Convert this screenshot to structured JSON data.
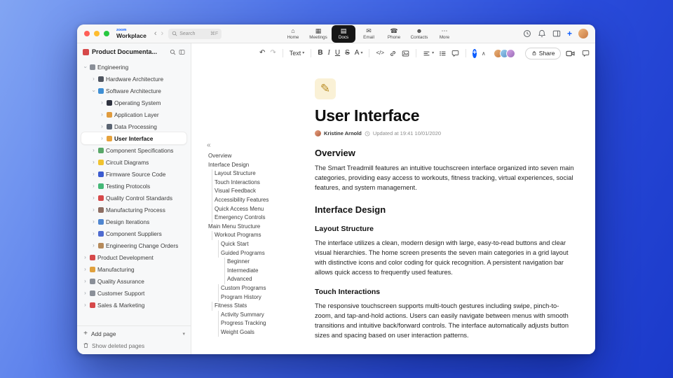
{
  "colors": {
    "accent": "#0b5cff",
    "active_tab_bg": "#161616",
    "desktop_gradient": [
      "#82a5f3",
      "#2a4cdb",
      "#1b3aca"
    ]
  },
  "titlebar": {
    "brand_top": "zoom",
    "brand_bottom": "Workplace",
    "search": {
      "placeholder": "Search",
      "shortcut": "⌘F"
    },
    "tabs": [
      {
        "label": "Home",
        "glyph": "⌂"
      },
      {
        "label": "Meetings",
        "glyph": "▦"
      },
      {
        "label": "Docs",
        "glyph": "▤",
        "active": true
      },
      {
        "label": "Email",
        "glyph": "✉"
      },
      {
        "label": "Phone",
        "glyph": "☎"
      },
      {
        "label": "Contacts",
        "glyph": "☻"
      },
      {
        "label": "More",
        "glyph": "⋯"
      }
    ]
  },
  "sidebar": {
    "title": "Product Documenta...",
    "tree": [
      {
        "label": "Engineering",
        "level": 0,
        "expanded": true,
        "icon": "gear-icon",
        "color": "#8a8f98"
      },
      {
        "label": "Hardware Architecture",
        "level": 1,
        "icon": "chip-icon",
        "color": "#4f5560"
      },
      {
        "label": "Software Architecture",
        "level": 1,
        "expanded": true,
        "icon": "disk-icon",
        "color": "#3f8fd4"
      },
      {
        "label": "Operating System",
        "level": 2,
        "icon": "device-icon",
        "color": "#2f3340"
      },
      {
        "label": "Application Layer",
        "level": 2,
        "icon": "package-icon",
        "color": "#e09b3d"
      },
      {
        "label": "Data Processing",
        "level": 2,
        "icon": "chart-icon",
        "color": "#5a6472"
      },
      {
        "label": "User Interface",
        "level": 2,
        "selected": true,
        "icon": "palette-icon",
        "color": "#e6a23c"
      },
      {
        "label": "Component Specifications",
        "level": 1,
        "icon": "puzzle-icon",
        "color": "#59a869"
      },
      {
        "label": "Circuit Diagrams",
        "level": 1,
        "icon": "bolt-icon",
        "color": "#f0c330"
      },
      {
        "label": "Firmware Source Code",
        "level": 1,
        "icon": "code-icon",
        "color": "#3b5bd0"
      },
      {
        "label": "Testing Protocols",
        "level": 1,
        "icon": "flask-icon",
        "color": "#45b877"
      },
      {
        "label": "Quality Control Standards",
        "level": 1,
        "icon": "target-icon",
        "color": "#d6494a"
      },
      {
        "label": "Manufacturing Process",
        "level": 1,
        "icon": "factory-icon",
        "color": "#8d6e63"
      },
      {
        "label": "Design Iterations",
        "level": 1,
        "icon": "ruler-icon",
        "color": "#4f86d0"
      },
      {
        "label": "Component Suppliers",
        "level": 1,
        "icon": "building-icon",
        "color": "#4f6bd0"
      },
      {
        "label": "Engineering Change Orders",
        "level": 1,
        "icon": "clipboard-icon",
        "color": "#b58a5a"
      },
      {
        "label": "Product Development",
        "level": 0,
        "icon": "rocket-icon",
        "color": "#d6494a"
      },
      {
        "label": "Manufacturing",
        "level": 0,
        "icon": "wrench-icon",
        "color": "#e0a13d"
      },
      {
        "label": "Quality Assurance",
        "level": 0,
        "icon": "ribbon-icon",
        "color": "#8a8f98"
      },
      {
        "label": "Customer Support",
        "level": 0,
        "icon": "chat-icon",
        "color": "#8a8f98"
      },
      {
        "label": "Sales & Marketing",
        "level": 0,
        "icon": "trend-icon",
        "color": "#d6494a"
      }
    ],
    "add_page": "Add page",
    "show_deleted": "Show deleted pages"
  },
  "toolbar": {
    "text_label": "Text",
    "bold": "B",
    "italic": "I",
    "underline": "U",
    "strike": "S",
    "color_letter": "A",
    "share_label": "Share",
    "avatars": [
      {
        "bg": "linear-gradient(135deg,#e8b27c,#c97b3e)"
      },
      {
        "bg": "linear-gradient(135deg,#9fd0f0,#5a92c8)"
      },
      {
        "bg": "linear-gradient(135deg,#d8a8e8,#9a6ab8)"
      }
    ]
  },
  "outline": {
    "items": [
      {
        "label": "Overview",
        "level": 0
      },
      {
        "label": "Interface Design",
        "level": 0
      },
      {
        "label": "Layout Structure",
        "level": 1
      },
      {
        "label": "Touch Interactions",
        "level": 1
      },
      {
        "label": "Visual Feedback",
        "level": 1
      },
      {
        "label": "Accessibility Features",
        "level": 1
      },
      {
        "label": "Quick Access Menu",
        "level": 1
      },
      {
        "label": "Emergency Controls",
        "level": 1
      },
      {
        "label": "Main Menu Structure",
        "level": 0
      },
      {
        "label": "Workout Programs",
        "level": 1
      },
      {
        "label": "Quick Start",
        "level": 2
      },
      {
        "label": "Guided Programs",
        "level": 2
      },
      {
        "label": "Beginner",
        "level": 3
      },
      {
        "label": "Intermediate",
        "level": 3
      },
      {
        "label": "Advanced",
        "level": 3
      },
      {
        "label": "Custom Programs",
        "level": 2
      },
      {
        "label": "Program History",
        "level": 2
      },
      {
        "label": "Fitness Stats",
        "level": 1
      },
      {
        "label": "Activity Summary",
        "level": 2
      },
      {
        "label": "Progress Tracking",
        "level": 2
      },
      {
        "label": "Weight Goals",
        "level": 2
      }
    ]
  },
  "document": {
    "title": "User Interface",
    "author": "Kristine Arnold",
    "updated": "Updated at 19:41 10/01/2020",
    "blocks": [
      {
        "type": "h2",
        "text": "Overview"
      },
      {
        "type": "p",
        "text": "The Smart Treadmill features an intuitive touchscreen interface organized into seven main categories, providing easy access to workouts, fitness tracking, virtual experiences, social features, and system management."
      },
      {
        "type": "h2",
        "text": "Interface Design"
      },
      {
        "type": "h3",
        "text": "Layout Structure"
      },
      {
        "type": "p",
        "text": "The interface utilizes a clean, modern design with large, easy-to-read buttons and clear visual hierarchies. The home screen presents the seven main categories in a grid layout with distinctive icons and color coding for quick recognition. A persistent navigation bar allows quick access to frequently used features."
      },
      {
        "type": "h3",
        "text": "Touch Interactions"
      },
      {
        "type": "p",
        "text": "The responsive touchscreen supports multi-touch gestures including swipe, pinch-to-zoom, and tap-and-hold actions. Users can easily navigate between menus with smooth transitions and intuitive back/forward controls. The interface automatically adjusts button sizes and spacing based on user interaction patterns."
      }
    ]
  }
}
